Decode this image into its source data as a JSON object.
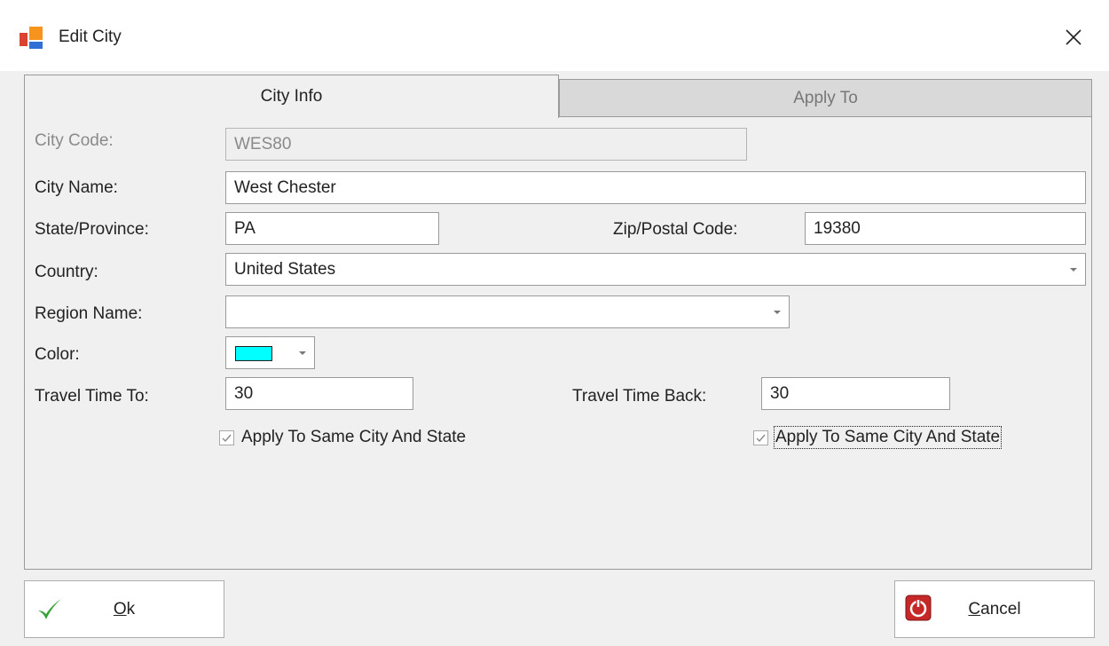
{
  "window": {
    "title": "Edit City"
  },
  "tabs": [
    {
      "label": "City Info",
      "active": true
    },
    {
      "label": "Apply To",
      "active": false
    }
  ],
  "form": {
    "city_code": {
      "label": "City Code:",
      "value": "WES80",
      "disabled": true
    },
    "city_name": {
      "label": "City Name:",
      "value": "West Chester"
    },
    "state": {
      "label": "State/Province:",
      "value": "PA"
    },
    "zip": {
      "label": "Zip/Postal Code:",
      "value": "19380"
    },
    "country": {
      "label": "Country:",
      "value": "United States"
    },
    "region": {
      "label": "Region Name:",
      "value": ""
    },
    "color": {
      "label": "Color:",
      "value": "#00ffff"
    },
    "travel_to": {
      "label": "Travel Time To:",
      "value": "30"
    },
    "travel_back": {
      "label": "Travel Time Back:",
      "value": "30"
    },
    "apply_to_check": {
      "label": "Apply To Same City And State",
      "checked": true
    },
    "apply_back_check": {
      "label": "Apply To Same City And State",
      "checked": true
    }
  },
  "buttons": {
    "ok": {
      "mnemonic": "O",
      "rest": "k"
    },
    "cancel": {
      "mnemonic": "C",
      "rest": "ancel"
    }
  },
  "colors": {
    "ok_check": "#3aa23a",
    "cancel_icon": "#c62828",
    "swatch": "#00ffff"
  }
}
